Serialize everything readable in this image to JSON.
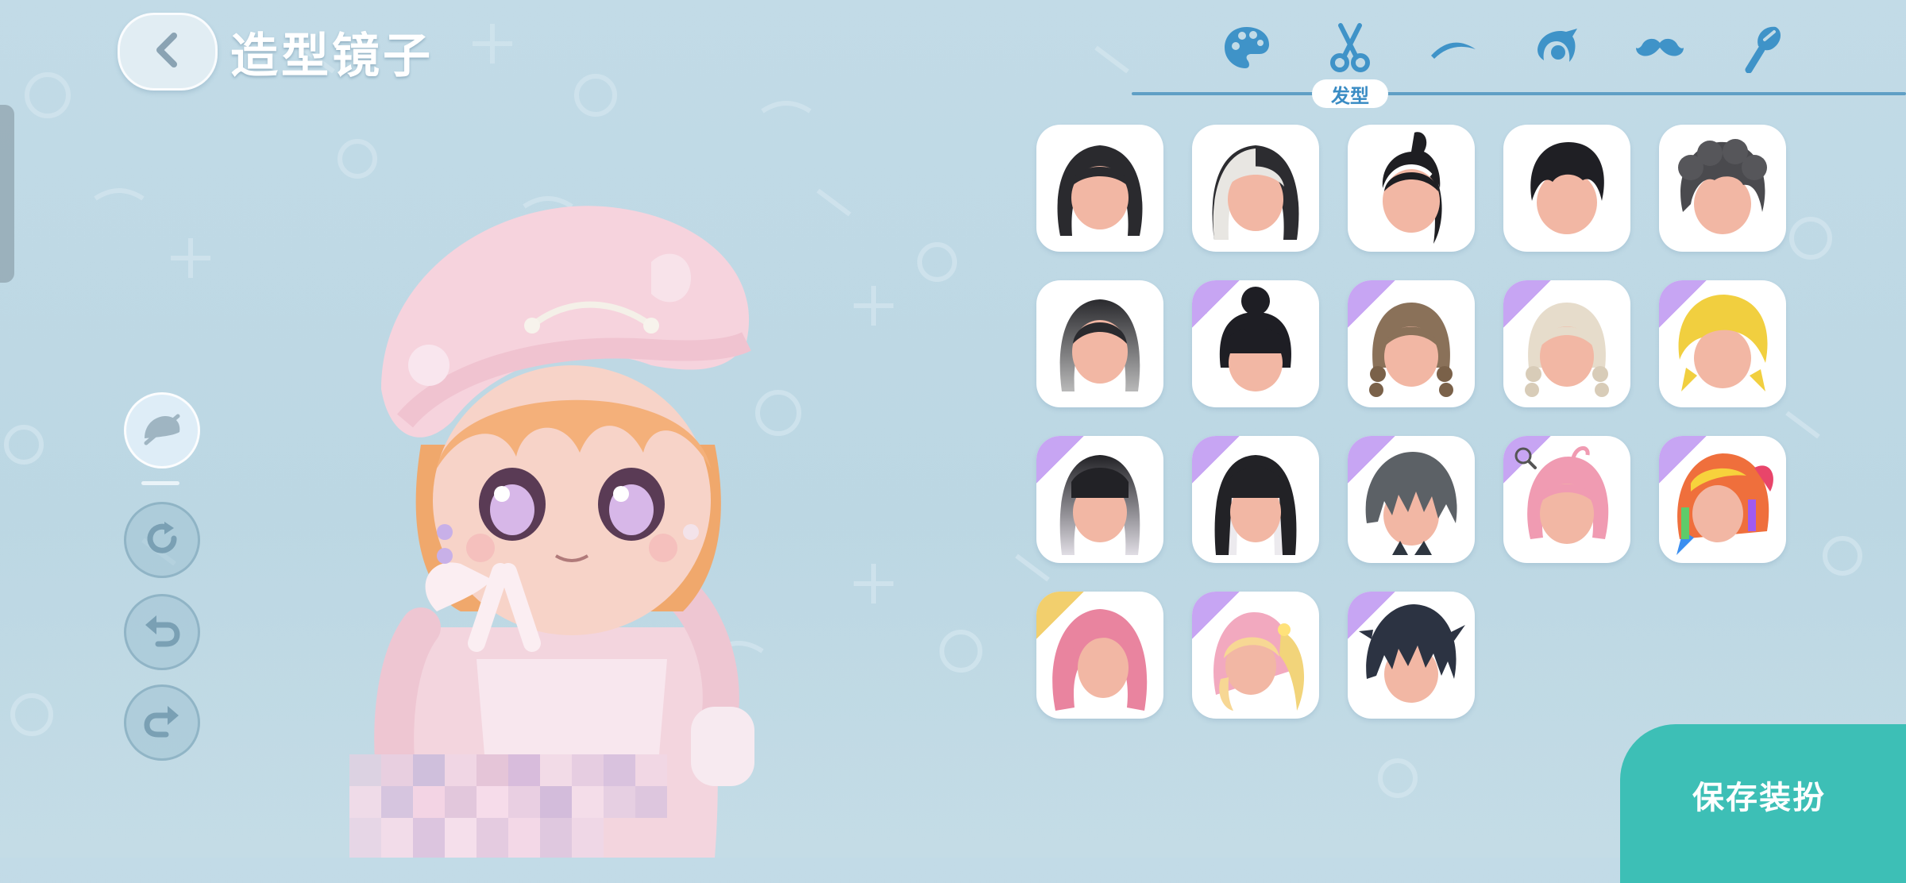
{
  "header": {
    "title": "造型镜子",
    "back_icon": "chevron-left-icon"
  },
  "tabs": {
    "items": [
      {
        "icon": "palette-icon",
        "name": "color"
      },
      {
        "icon": "scissors-icon",
        "name": "hair"
      },
      {
        "icon": "eyebrow-icon",
        "name": "eyebrow"
      },
      {
        "icon": "eye-icon",
        "name": "eye"
      },
      {
        "icon": "mustache-icon",
        "name": "mustache"
      },
      {
        "icon": "brush-icon",
        "name": "makeup"
      }
    ],
    "active_label": "发型"
  },
  "hairstyles": [
    {
      "style": "long-black",
      "rarity": "normal"
    },
    {
      "style": "long-silver-black",
      "rarity": "normal"
    },
    {
      "style": "high-ponytail-black",
      "rarity": "normal"
    },
    {
      "style": "short-black",
      "rarity": "normal"
    },
    {
      "style": "curly-gray",
      "rarity": "normal"
    },
    {
      "style": "bob-ombre-gray",
      "rarity": "normal"
    },
    {
      "style": "bun-black",
      "rarity": "rare"
    },
    {
      "style": "braids-brown",
      "rarity": "rare"
    },
    {
      "style": "braids-cream",
      "rarity": "rare"
    },
    {
      "style": "messy-yellow",
      "rarity": "rare"
    },
    {
      "style": "bangs-black-white",
      "rarity": "rare"
    },
    {
      "style": "straight-black-white",
      "rarity": "rare"
    },
    {
      "style": "spiky-gray",
      "rarity": "rare"
    },
    {
      "style": "pink-short-search",
      "rarity": "rare"
    },
    {
      "style": "rainbow",
      "rarity": "rare"
    },
    {
      "style": "long-pink",
      "rarity": "legendary"
    },
    {
      "style": "blonde-pink-twintail",
      "rarity": "rare"
    },
    {
      "style": "spiky-dark-blue",
      "rarity": "rare"
    }
  ],
  "tools": [
    {
      "icon": "hide-hat-icon",
      "active": true
    },
    {
      "icon": "rotate-icon",
      "active": false
    },
    {
      "icon": "undo-icon",
      "active": false
    },
    {
      "icon": "redo-icon",
      "active": false
    }
  ],
  "save_button": {
    "label": "保存装扮"
  },
  "colors": {
    "background": "#c2dbe7",
    "accent_blue": "#3a8cc4",
    "save_teal": "#3dbfb6",
    "rare_purple": "#c7a5f3",
    "legendary_gold": "#f2cf6d"
  }
}
